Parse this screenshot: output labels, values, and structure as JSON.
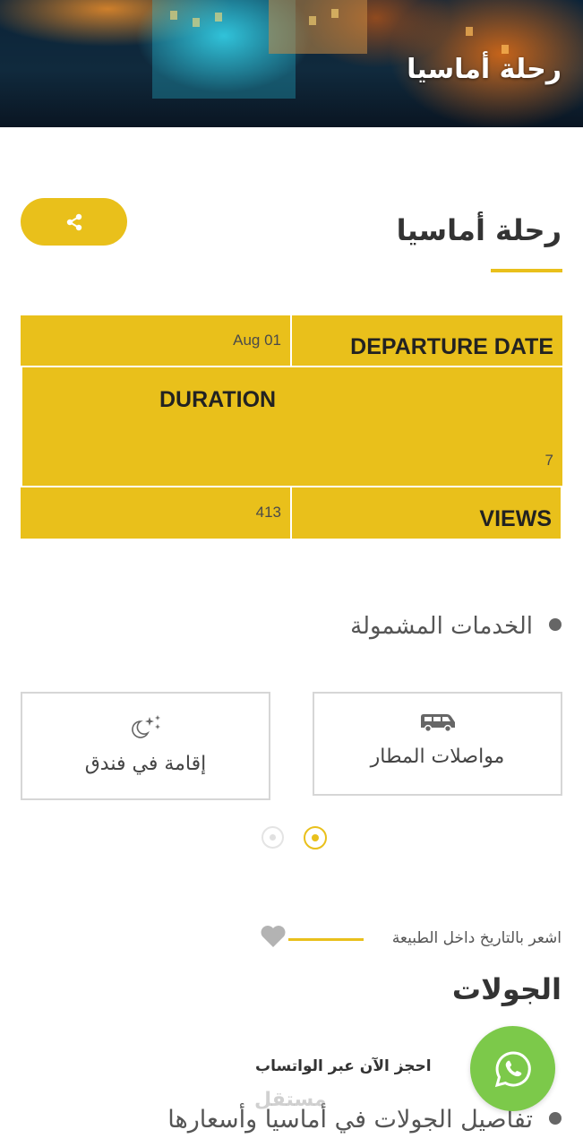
{
  "hero": {
    "title": "رحلة أماسيا"
  },
  "page": {
    "title": "رحلة أماسيا"
  },
  "share": {
    "icon": "share-icon"
  },
  "info": {
    "departure_label": "DEPARTURE DATE",
    "departure_value": "Aug 01",
    "duration_label": "DURATION",
    "duration_value": "7",
    "views_label": "VIEWS",
    "views_value": "413"
  },
  "services": {
    "heading": "الخدمات المشمولة",
    "items": [
      {
        "label": "مواصلات المطار",
        "icon": "van-icon"
      },
      {
        "label": "إقامة في فندق",
        "icon": "moon-stars-icon"
      }
    ],
    "active_page": 1,
    "page_count": 2
  },
  "tours": {
    "tagline": "اشعر بالتاريخ داخل الطبيعة",
    "heading": "الجولات",
    "whatsapp_text": "احجز الآن عبر الواتساب",
    "details": "تفاصيل الجولات في أماسيا وأسعارها"
  },
  "watermark": "مستقل",
  "colors": {
    "accent": "#e9c01b",
    "whatsapp": "#7cc94a",
    "text": "#333333"
  }
}
